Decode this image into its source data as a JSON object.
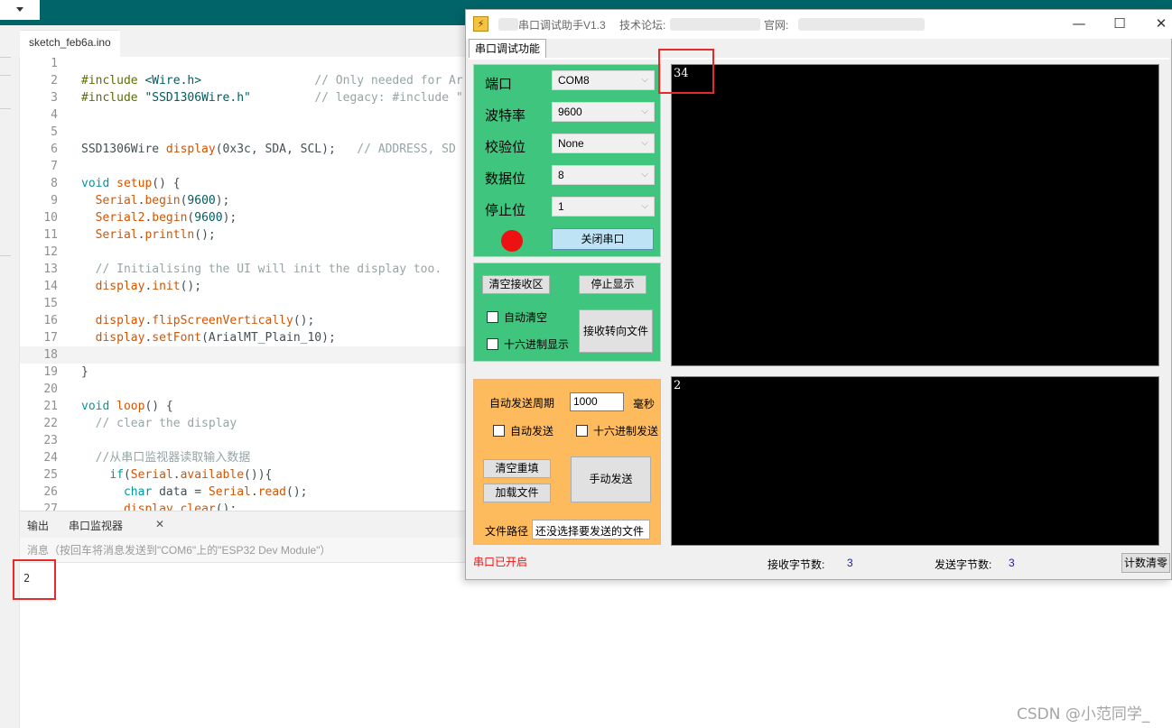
{
  "ide": {
    "file_tab": "sketch_feb6a.ino",
    "code_lines": [
      {
        "n": "1",
        "parts": []
      },
      {
        "n": "2",
        "parts": [
          {
            "c": "t-pre",
            "t": "#include "
          },
          {
            "c": "t-str",
            "t": "<Wire.h>"
          },
          {
            "c": "t-pl",
            "t": "                "
          },
          {
            "c": "t-cm",
            "t": "// Only needed for Ar"
          }
        ]
      },
      {
        "n": "3",
        "parts": [
          {
            "c": "t-pre",
            "t": "#include "
          },
          {
            "c": "t-str",
            "t": "\"SSD1306Wire.h\""
          },
          {
            "c": "t-pl",
            "t": "         "
          },
          {
            "c": "t-cm",
            "t": "// legacy: #include \""
          }
        ]
      },
      {
        "n": "4",
        "parts": []
      },
      {
        "n": "5",
        "parts": []
      },
      {
        "n": "6",
        "parts": [
          {
            "c": "t-pl",
            "t": "SSD1306Wire "
          },
          {
            "c": "t-fn",
            "t": "display"
          },
          {
            "c": "t-pl",
            "t": "(0x3c, SDA, SCL);   "
          },
          {
            "c": "t-cm",
            "t": "// ADDRESS, SD"
          }
        ]
      },
      {
        "n": "7",
        "parts": []
      },
      {
        "n": "8",
        "parts": [
          {
            "c": "t-kw",
            "t": "void"
          },
          {
            "c": "t-pl",
            "t": " "
          },
          {
            "c": "t-fn",
            "t": "setup"
          },
          {
            "c": "t-pl",
            "t": "() {"
          }
        ]
      },
      {
        "n": "9",
        "parts": [
          {
            "c": "t-pl",
            "t": "  "
          },
          {
            "c": "t-fn",
            "t": "Serial"
          },
          {
            "c": "t-pl",
            "t": "."
          },
          {
            "c": "t-fn",
            "t": "begin"
          },
          {
            "c": "t-pl",
            "t": "("
          },
          {
            "c": "t-num",
            "t": "9600"
          },
          {
            "c": "t-pl",
            "t": ");"
          }
        ]
      },
      {
        "n": "10",
        "parts": [
          {
            "c": "t-pl",
            "t": "  "
          },
          {
            "c": "t-fn",
            "t": "Serial2"
          },
          {
            "c": "t-pl",
            "t": "."
          },
          {
            "c": "t-fn",
            "t": "begin"
          },
          {
            "c": "t-pl",
            "t": "("
          },
          {
            "c": "t-num",
            "t": "9600"
          },
          {
            "c": "t-pl",
            "t": ");"
          }
        ]
      },
      {
        "n": "11",
        "parts": [
          {
            "c": "t-pl",
            "t": "  "
          },
          {
            "c": "t-fn",
            "t": "Serial"
          },
          {
            "c": "t-pl",
            "t": "."
          },
          {
            "c": "t-fn",
            "t": "println"
          },
          {
            "c": "t-pl",
            "t": "();"
          }
        ]
      },
      {
        "n": "12",
        "parts": []
      },
      {
        "n": "13",
        "parts": [
          {
            "c": "t-pl",
            "t": "  "
          },
          {
            "c": "t-cm",
            "t": "// Initialising the UI will init the display too."
          }
        ]
      },
      {
        "n": "14",
        "parts": [
          {
            "c": "t-pl",
            "t": "  "
          },
          {
            "c": "t-fn",
            "t": "display"
          },
          {
            "c": "t-pl",
            "t": "."
          },
          {
            "c": "t-fn",
            "t": "init"
          },
          {
            "c": "t-pl",
            "t": "();"
          }
        ]
      },
      {
        "n": "15",
        "parts": []
      },
      {
        "n": "16",
        "parts": [
          {
            "c": "t-pl",
            "t": "  "
          },
          {
            "c": "t-fn",
            "t": "display"
          },
          {
            "c": "t-pl",
            "t": "."
          },
          {
            "c": "t-fn",
            "t": "flipScreenVertically"
          },
          {
            "c": "t-pl",
            "t": "();"
          }
        ]
      },
      {
        "n": "17",
        "parts": [
          {
            "c": "t-pl",
            "t": "  "
          },
          {
            "c": "t-fn",
            "t": "display"
          },
          {
            "c": "t-pl",
            "t": "."
          },
          {
            "c": "t-fn",
            "t": "setFont"
          },
          {
            "c": "t-pl",
            "t": "(ArialMT_Plain_10);"
          }
        ]
      },
      {
        "n": "18",
        "parts": [],
        "active": true
      },
      {
        "n": "19",
        "parts": [
          {
            "c": "t-pl",
            "t": "}"
          }
        ]
      },
      {
        "n": "20",
        "parts": []
      },
      {
        "n": "21",
        "parts": [
          {
            "c": "t-kw",
            "t": "void"
          },
          {
            "c": "t-pl",
            "t": " "
          },
          {
            "c": "t-fn",
            "t": "loop"
          },
          {
            "c": "t-pl",
            "t": "() {"
          }
        ]
      },
      {
        "n": "22",
        "parts": [
          {
            "c": "t-pl",
            "t": "  "
          },
          {
            "c": "t-cm",
            "t": "// clear the display"
          }
        ]
      },
      {
        "n": "23",
        "parts": []
      },
      {
        "n": "24",
        "parts": [
          {
            "c": "t-pl",
            "t": "  "
          },
          {
            "c": "t-cm",
            "t": "//从串口监视器读取输入数据"
          }
        ]
      },
      {
        "n": "25",
        "parts": [
          {
            "c": "t-pl",
            "t": "    "
          },
          {
            "c": "t-kw",
            "t": "if"
          },
          {
            "c": "t-pl",
            "t": "("
          },
          {
            "c": "t-fn",
            "t": "Serial"
          },
          {
            "c": "t-pl",
            "t": "."
          },
          {
            "c": "t-fn",
            "t": "available"
          },
          {
            "c": "t-pl",
            "t": "()){"
          }
        ]
      },
      {
        "n": "26",
        "parts": [
          {
            "c": "t-pl",
            "t": "      "
          },
          {
            "c": "t-kw",
            "t": "char"
          },
          {
            "c": "t-pl",
            "t": " data = "
          },
          {
            "c": "t-fn",
            "t": "Serial"
          },
          {
            "c": "t-pl",
            "t": "."
          },
          {
            "c": "t-fn",
            "t": "read"
          },
          {
            "c": "t-pl",
            "t": "();"
          }
        ]
      },
      {
        "n": "27",
        "parts": [
          {
            "c": "t-pl",
            "t": "      "
          },
          {
            "c": "t-fn",
            "t": "display"
          },
          {
            "c": "t-pl",
            "t": "."
          },
          {
            "c": "t-fn",
            "t": "clear"
          },
          {
            "c": "t-pl",
            "t": "();"
          }
        ]
      }
    ],
    "bottom_tabs": {
      "output": "输出",
      "serial_monitor": "串口监视器",
      "close": "✕"
    },
    "message_placeholder": "消息（按回车将消息发送到\"COM6\"上的\"ESP32 Dev Module\"）",
    "serial_output": "2"
  },
  "tool": {
    "title": "串口调试助手V1.3",
    "forum_label": "技术论坛:",
    "site_label": "官网:",
    "window_controls": {
      "minimize": "—",
      "maximize": "☐",
      "close": "✕"
    },
    "func_tab": "串口调试功能",
    "settings": [
      {
        "label": "端口",
        "value": "COM8"
      },
      {
        "label": "波特率",
        "value": "9600"
      },
      {
        "label": "校验位",
        "value": "None"
      },
      {
        "label": "数据位",
        "value": "8"
      },
      {
        "label": "停止位",
        "value": "1"
      }
    ],
    "status_led_color": "#ee1111",
    "close_port_button": "关闭串口",
    "receive": {
      "clear_button": "清空接收区",
      "stop_display_button": "停止显示",
      "auto_clear_label": "自动清空",
      "hex_display_label": "十六进制显示",
      "to_file_button": "接收转向文件",
      "content": "34"
    },
    "send": {
      "period_label": "自动发送周期",
      "period_value": "1000",
      "period_unit": "毫秒",
      "auto_send_label": "自动发送",
      "hex_send_label": "十六进制发送",
      "clear_refill_button": "清空重填",
      "load_file_button": "加载文件",
      "manual_send_button": "手动发送",
      "file_path_label": "文件路径",
      "file_path_value": "还没选择要发送的文件",
      "content": "2"
    },
    "status": {
      "port_status": "串口已开启",
      "rx_count_label": "接收字节数:",
      "rx_count": "3",
      "tx_count_label": "发送字节数:",
      "tx_count": "3",
      "clear_counts_button": "计数清零"
    },
    "colors": {
      "panel_green": "#3fc57d",
      "panel_orange": "#fdbb5e",
      "terminal_bg": "#000000",
      "annotation_red": "#e8292a"
    }
  },
  "watermark": "CSDN @小范同学_"
}
